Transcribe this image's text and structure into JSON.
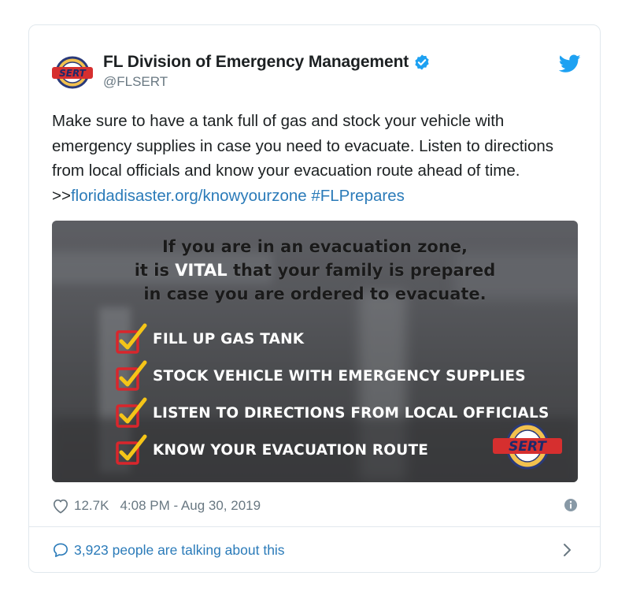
{
  "account": {
    "display_name": "FL Division of Emergency Management",
    "handle": "@FLSERT",
    "logo_text": "SERT"
  },
  "tweet": {
    "text_plain": "Make sure to have a tank full of gas and stock your vehicle with emergency supplies in case you need to evacuate. Listen to directions from local officials and know your evacuation route ahead of time. >>",
    "link_text": "floridadisaster.org/knowyourzone",
    "hashtag": "#FLPrepares"
  },
  "media": {
    "headline_line1": "If you are in an evacuation zone,",
    "headline_line2_pre": "it is ",
    "headline_vital": "VITAL",
    "headline_line2_post": " that your family is prepared",
    "headline_line3": "in case you are ordered to evacuate.",
    "checklist": [
      "FILL UP GAS TANK",
      "STOCK VEHICLE WITH EMERGENCY SUPPLIES",
      "LISTEN TO DIRECTIONS FROM LOCAL OFFICIALS",
      "KNOW YOUR EVACUATION ROUTE"
    ],
    "seal_text": "SERT"
  },
  "meta": {
    "like_count": "12.7K",
    "timestamp": "4:08 PM - Aug 30, 2019"
  },
  "footer": {
    "talking": "3,923 people are talking about this"
  },
  "icons": {
    "verified": "verified-badge-icon",
    "bird": "twitter-bird-icon",
    "heart": "heart-icon",
    "info": "info-icon",
    "bubble": "speech-bubble-icon",
    "chevron": "chevron-right-icon"
  },
  "colors": {
    "link": "#2b7bb9",
    "muted": "#697882",
    "verified": "#1da1f2",
    "check_box": "#d9262c",
    "check_mark": "#f5c518",
    "vital": "#ffffff"
  }
}
